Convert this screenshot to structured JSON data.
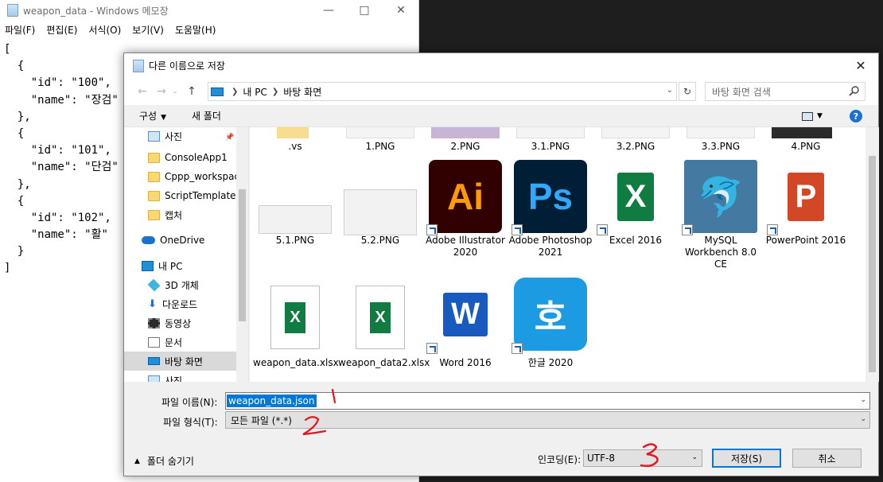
{
  "notepad": {
    "title": "weapon_data - Windows 메모장",
    "menu": [
      "파일(F)",
      "편집(E)",
      "서식(O)",
      "보기(V)",
      "도움말(H)"
    ],
    "lines": [
      "[",
      "  {",
      "    \"id\": \"100\",",
      "    \"name\": \"장검\"",
      "  },",
      "  {",
      "    \"id\": \"101\",",
      "    \"name\": \"단검\"",
      "  },",
      "  {",
      "    \"id\": \"102\",",
      "    \"name\": \"활\"",
      "  }",
      "]"
    ]
  },
  "dialog": {
    "title": "다른 이름으로 저장",
    "address": [
      "내 PC",
      "바탕 화면"
    ],
    "search_placeholder": "바탕 화면 검색",
    "toolbar": {
      "organize": "구성",
      "new_folder": "새 폴더"
    },
    "nav_items": [
      {
        "label": "사진",
        "icon": "pictures-icon",
        "pinned": true
      },
      {
        "label": "ConsoleApp1",
        "icon": "folder-icon"
      },
      {
        "label": "Cppp_workspace",
        "icon": "folder-icon"
      },
      {
        "label": "ScriptTemplates",
        "icon": "folder-icon"
      },
      {
        "label": "캡처",
        "icon": "folder-icon"
      },
      {
        "label": "OneDrive",
        "icon": "onedrive-icon"
      },
      {
        "label": "내 PC",
        "icon": "this-pc-icon"
      },
      {
        "label": "3D 개체",
        "icon": "3d-objects-icon"
      },
      {
        "label": "다운로드",
        "icon": "downloads-icon"
      },
      {
        "label": "동영상",
        "icon": "videos-icon"
      },
      {
        "label": "문서",
        "icon": "documents-icon"
      },
      {
        "label": "바탕 화면",
        "icon": "desktop-icon",
        "selected": true
      },
      {
        "label": "사진",
        "icon": "pictures-icon"
      }
    ],
    "files_row1": [
      ".vs",
      "1.PNG",
      "2.PNG",
      "3.1.PNG",
      "3.2.PNG",
      "3.3.PNG",
      "4.PNG"
    ],
    "files_row2": [
      {
        "label": "5.1.PNG",
        "kind": "screenshot"
      },
      {
        "label": "5.2.PNG",
        "kind": "screenshot"
      },
      {
        "label": "Adobe Illustrator 2020",
        "kind": "illustrator",
        "glyph": "Ai"
      },
      {
        "label": "Adobe Photoshop 2021",
        "kind": "photoshop",
        "glyph": "Ps"
      },
      {
        "label": "Excel 2016",
        "kind": "excel",
        "glyph": "X"
      },
      {
        "label": "MySQL Workbench 8.0 CE",
        "kind": "mysql"
      },
      {
        "label": "PowerPoint 2016",
        "kind": "powerpoint",
        "glyph": "P"
      }
    ],
    "files_row3": [
      {
        "label": "weapon_data.xlsx",
        "kind": "xlsx",
        "glyph": "X"
      },
      {
        "label": "weapon_data2.xlsx",
        "kind": "xlsx",
        "glyph": "X"
      },
      {
        "label": "Word 2016",
        "kind": "word",
        "glyph": "W"
      },
      {
        "label": "한글 2020",
        "kind": "hangul",
        "glyph": "호"
      }
    ],
    "file_name_label": "파일 이름(N):",
    "file_name_value": "weapon_data.json",
    "file_type_label": "파일 형식(T):",
    "file_type_value": "모든 파일 (*.*)",
    "hide_folders": "폴더 숨기기",
    "encoding_label": "인코딩(E):",
    "encoding_value": "UTF-8",
    "save_button": "저장(S)",
    "cancel_button": "취소"
  },
  "annotations": {
    "color": "#e8141b",
    "marks": [
      "1",
      "2",
      "3"
    ]
  }
}
